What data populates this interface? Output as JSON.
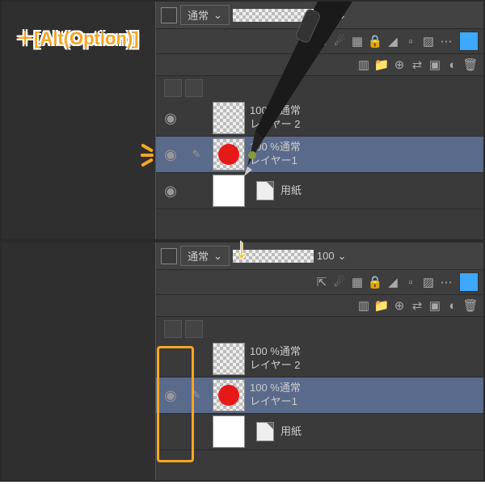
{
  "annotation": {
    "hotkey": "＋[Alt(Option)]"
  },
  "toolbar": {
    "blend_mode": "通常",
    "opacity": "100"
  },
  "layers": [
    {
      "opacity": "100 %通常",
      "name": "レイヤー 2",
      "visible": true,
      "selected": false,
      "thumb": "checker"
    },
    {
      "opacity": "100 %通常",
      "name": "レイヤー1",
      "visible": true,
      "selected": true,
      "thumb": "reddot"
    },
    {
      "opacity": "",
      "name": "用紙",
      "visible": true,
      "selected": false,
      "thumb": "paper"
    }
  ],
  "panel2_layers": [
    {
      "opacity": "100 %通常",
      "name": "レイヤー 2",
      "visible": false,
      "selected": false,
      "thumb": "checker"
    },
    {
      "opacity": "100 %通常",
      "name": "レイヤー1",
      "visible": true,
      "selected": true,
      "thumb": "reddot"
    },
    {
      "opacity": "",
      "name": "用紙",
      "visible": false,
      "selected": false,
      "thumb": "paper"
    }
  ]
}
